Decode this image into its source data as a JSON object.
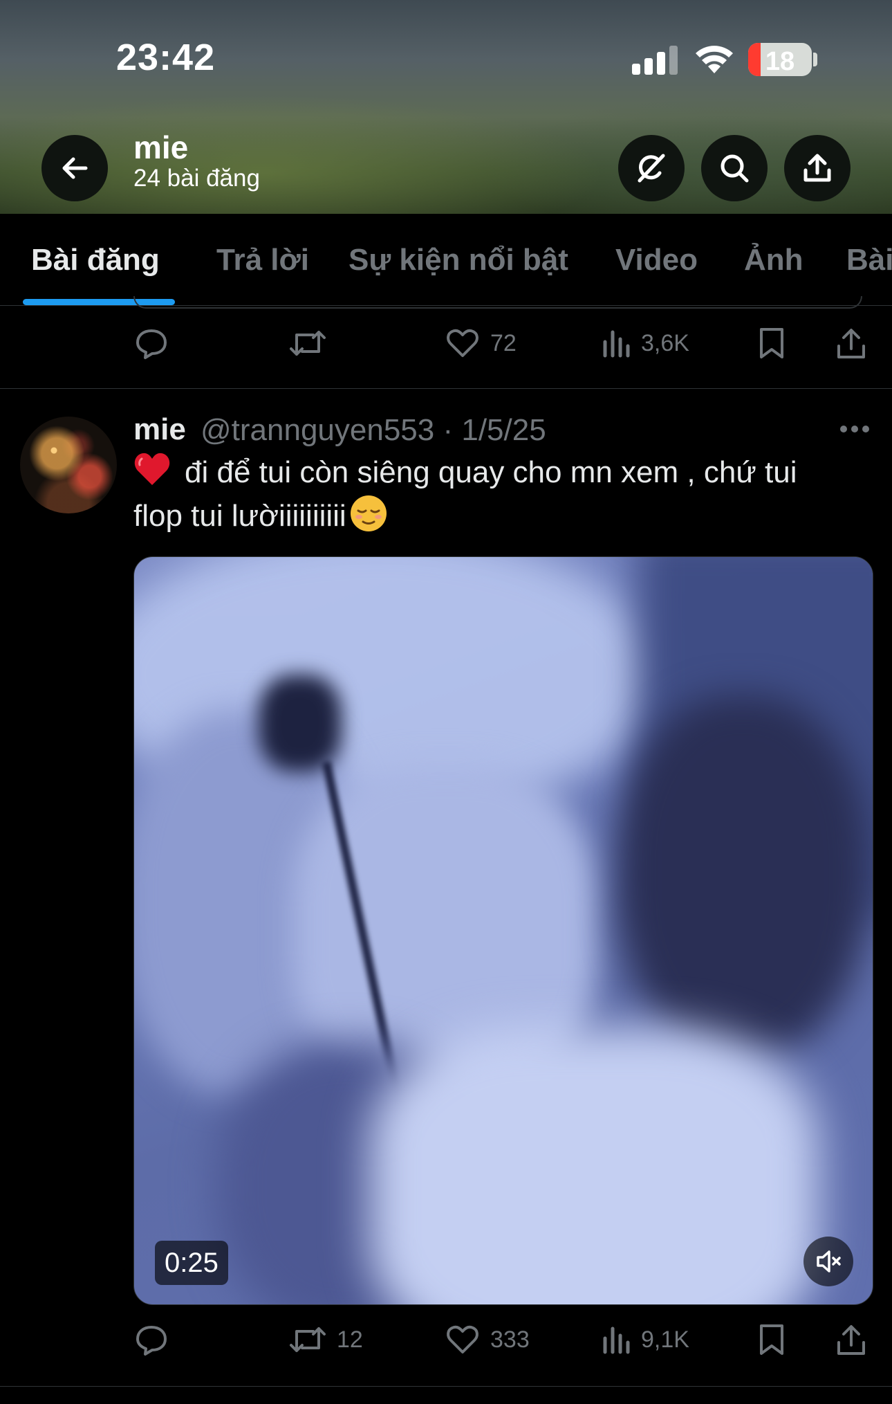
{
  "status_bar": {
    "time": "23:42",
    "battery": "18"
  },
  "header": {
    "name": "mie",
    "post_count": "24 bài đăng"
  },
  "tabs": [
    "Bài đăng",
    "Trả lời",
    "Sự kiện nổi bật",
    "Video",
    "Ảnh",
    "Bài"
  ],
  "previous_tweet": {
    "reply_count": "",
    "retweet_count": "",
    "like_count": "72",
    "view_count": "3,6K"
  },
  "tweet": {
    "display_name": "mie",
    "handle": "@trannguyen553",
    "date": "1/5/25",
    "meta": "@trannguyen553 · 1/5/25",
    "text_line1": "đi để tui còn siêng quay cho mn xem , chứ tui",
    "text_line2": "flop tui lườiiiiiiiiii",
    "video_duration": "0:25",
    "reply_count": "",
    "retweet_count": "12",
    "like_count": "333",
    "view_count": "9,1K"
  },
  "colors": {
    "background": "#000000",
    "text": "#e7e9ea",
    "muted": "#71767b",
    "accent": "#1d9bf0",
    "divider": "#2f3336"
  },
  "icons": [
    "back-arrow-icon",
    "grok-icon",
    "search-icon",
    "share-icon",
    "reply-icon",
    "retweet-icon",
    "like-icon",
    "views-icon",
    "bookmark-icon",
    "more-icon",
    "mute-icon"
  ]
}
